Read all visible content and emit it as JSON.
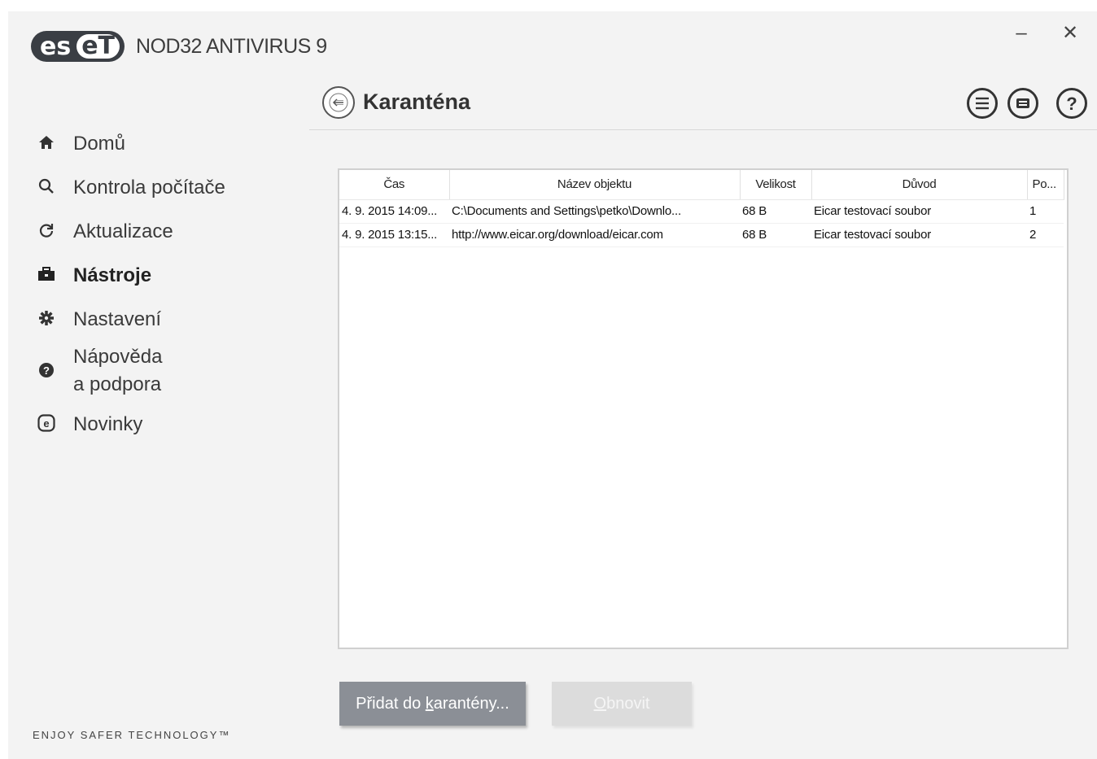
{
  "app": {
    "logo_left": "es",
    "logo_right": "eT",
    "product_name": "NOD32 ANTIVIRUS 9",
    "minimize_glyph": "–",
    "close_glyph": "✕"
  },
  "sidebar": {
    "items": [
      {
        "label": "Domů",
        "icon": "home-icon",
        "active": false
      },
      {
        "label": "Kontrola počítače",
        "icon": "search-icon",
        "active": false
      },
      {
        "label": "Aktualizace",
        "icon": "refresh-icon",
        "active": false
      },
      {
        "label": "Nástroje",
        "icon": "toolbox-icon",
        "active": true
      },
      {
        "label": "Nastavení",
        "icon": "gear-icon",
        "active": false
      },
      {
        "label": "Nápověda",
        "label2": "a podpora",
        "icon": "help-icon",
        "active": false
      },
      {
        "label": "Novinky",
        "icon": "news-icon",
        "active": false
      }
    ],
    "tagline": "ENJOY SAFER TECHNOLOGY™"
  },
  "header": {
    "title": "Karanténa",
    "icons": [
      "list-icon",
      "menu-icon",
      "help-icon"
    ]
  },
  "table": {
    "columns": [
      "Čas",
      "Název objektu",
      "Velikost",
      "Důvod",
      "Po..."
    ],
    "rows": [
      [
        "4. 9. 2015 14:09...",
        "C:\\Documents and Settings\\petko\\Downlo...",
        "68 B",
        "Eicar testovací soubor",
        "1"
      ],
      [
        "4. 9. 2015 13:15...",
        "http://www.eicar.org/download/eicar.com",
        "68 B",
        "Eicar testovací soubor",
        "2"
      ]
    ]
  },
  "buttons": {
    "add_pre": "Přidat do ",
    "add_key": "k",
    "add_post": "arantény...",
    "restore_key": "O",
    "restore_post": "bnovit"
  },
  "colors": {
    "primary_button": "#8b8f96",
    "disabled_button": "#dcdcdc",
    "background": "#f3f3f3"
  }
}
